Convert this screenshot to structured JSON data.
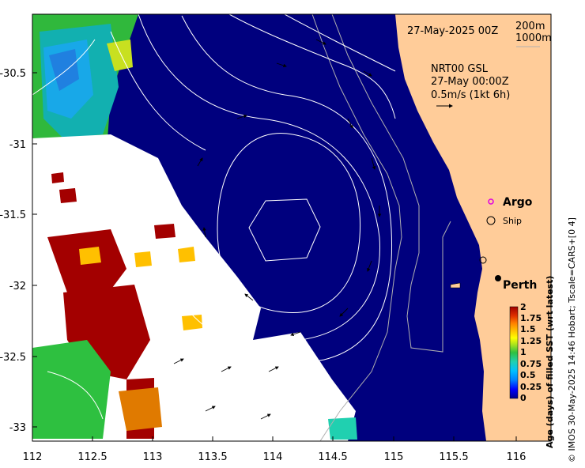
{
  "header": {
    "date_label": "27-May-2025 00Z",
    "depth_200": "200m",
    "depth_1000": "1000m"
  },
  "current_legend": {
    "line1": "NRT00 GSL",
    "line2": "27-May 00:00Z",
    "line3": "0.5m/s (1kt 6h)"
  },
  "markers": {
    "argo_label": "Argo",
    "ship_label": "Ship",
    "city_label": "Perth"
  },
  "axes": {
    "x_ticks": [
      "112",
      "112.5",
      "113",
      "113.5",
      "114",
      "114.5",
      "115",
      "115.5",
      "116"
    ],
    "y_ticks": [
      "-30.5",
      "-31",
      "-31.5",
      "-32",
      "-32.5",
      "-33"
    ]
  },
  "colorbar": {
    "title": "Age (days) of filled SST (wrt latest)",
    "ticks": [
      "2",
      "1.75",
      "1.5",
      "1.25",
      "1",
      "0.75",
      "0.5",
      "0.25",
      "0"
    ],
    "colors": [
      "#00008b",
      "#0000ff",
      "#0080ff",
      "#00c0ff",
      "#20d0b0",
      "#30c040",
      "#a0e020",
      "#ffff00",
      "#ffc000",
      "#ff8000",
      "#e03000",
      "#a00000"
    ]
  },
  "side_text": "© IMOS 30-May-2025 14:46 Hobart; Tscale=CARS+[0 4]",
  "colors": {
    "ocean_dark": "#00007e",
    "land": "#ffcc99",
    "cloud": "#ffffff"
  }
}
